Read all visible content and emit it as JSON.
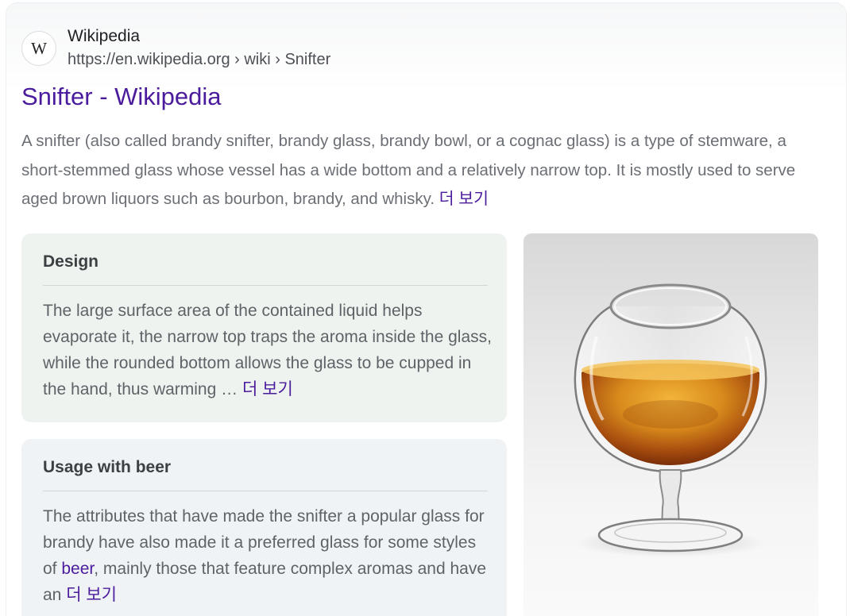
{
  "result": {
    "favicon_letter": "W",
    "site_name": "Wikipedia",
    "breadcrumb": "https://en.wikipedia.org › wiki › Snifter",
    "title": "Snifter - Wikipedia",
    "snippet": "A snifter (also called brandy snifter, brandy glass, brandy bowl, or a cognac glass) is a type of stemware, a short-stemmed glass whose vessel has a wide bottom and a relatively narrow top. It is mostly used to serve aged brown liquors such as bourbon, brandy, and whisky.",
    "more_label": "더 보기"
  },
  "sections": [
    {
      "heading": "Design",
      "text": "The large surface area of the contained liquid helps evaporate it, the narrow top traps the aroma inside the glass, while the rounded bottom allows the glass to be cupped in the hand, thus warming …",
      "more_label": "더 보기"
    },
    {
      "heading": "Usage with beer",
      "text_before": "The attributes that have made the snifter a popular glass for brandy have also made it a preferred glass for some styles of",
      "link": "beer",
      "text_after": ", mainly those that feature complex aromas and have an",
      "more_label": "더 보기"
    }
  ],
  "image": {
    "subject": "brandy snifter glass with amber liquor"
  },
  "colors": {
    "link": "#4a1b9c",
    "snippet_text": "#6b6f75",
    "design_panel_bg": "#eff3ef",
    "beer_panel_bg": "#f0f3f6"
  }
}
